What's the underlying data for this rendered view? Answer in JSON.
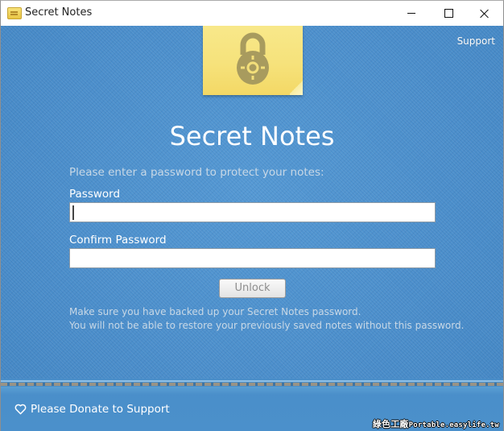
{
  "window": {
    "title": "Secret Notes",
    "controls": {
      "minimize": "minimize",
      "maximize": "maximize",
      "close": "close"
    }
  },
  "header": {
    "support_link": "Support",
    "logo_icon": "sticky-note-lock-icon"
  },
  "main": {
    "title": "Secret Notes",
    "prompt": "Please enter a password to protect your notes:",
    "password_label": "Password",
    "password_value": "",
    "confirm_label": "Confirm Password",
    "confirm_value": "",
    "unlock_button": "Unlock",
    "warning_line1": "Make sure you have backed up your Secret Notes password.",
    "warning_line2": "You will not be able to restore your previously saved notes without this password."
  },
  "footer": {
    "donate_label": "Please Donate to Support",
    "donate_icon": "heart-icon",
    "watermark_cjk": "綠色工廠",
    "watermark_url": "Portable.easylife.tw"
  },
  "colors": {
    "denim": "#4a8fcc",
    "note_yellow": "#f6e27b",
    "lock_olive": "#a79a5c",
    "text_white": "#ffffff",
    "text_muted": "#c8d8e6"
  }
}
